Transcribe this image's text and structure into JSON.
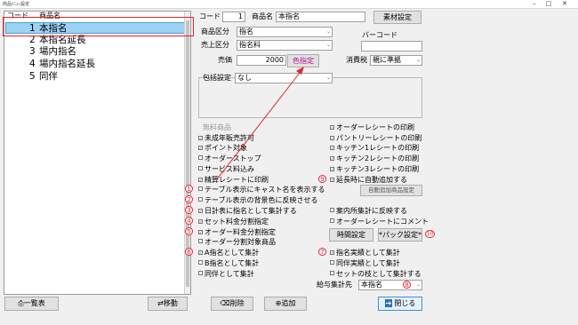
{
  "window": {
    "title": "商品ﾒﾆｭｰ設定"
  },
  "list": {
    "header_code": "コード",
    "header_name": "商品名",
    "items": [
      {
        "code": "1",
        "name": "本指名"
      },
      {
        "code": "2",
        "name": "本指名延長"
      },
      {
        "code": "3",
        "name": "場内指名"
      },
      {
        "code": "4",
        "name": "場内指名延長"
      },
      {
        "code": "5",
        "name": "同伴"
      }
    ]
  },
  "form": {
    "code_label": "コード",
    "code_value": "1",
    "name_label": "商品名",
    "name_value": "本指名",
    "material_button": "素材設定",
    "category_label": "商品区分",
    "category_value": "指名",
    "sales_category_label": "売上区分",
    "sales_category_value": "指名料",
    "barcode_label": "バーコード",
    "barcode_value": "",
    "price_label": "売価",
    "price_value": "2000",
    "color_button": "色指定",
    "tax_label": "消費税",
    "tax_value": "親に準拠",
    "package_label": "包括設定",
    "package_value": "なし"
  },
  "left_checks": [
    {
      "label": "無料商品",
      "checked": false,
      "disabled": true
    },
    {
      "label": "未成年販売許可",
      "checked": true
    },
    {
      "label": "ポイント対象",
      "checked": true
    },
    {
      "label": "オーダーストップ",
      "checked": false
    },
    {
      "label": "サービス料込み",
      "checked": false
    },
    {
      "label": "精算レシートに印刷",
      "checked": true
    },
    {
      "label": "テーブル表示にキャスト名を表示する",
      "checked": false,
      "num": "1"
    },
    {
      "label": "テーブル表示の背景色に反映させる",
      "checked": false,
      "num": "2"
    },
    {
      "label": "日計表に指名として集計する",
      "checked": true,
      "num": "3"
    },
    {
      "label": "セット料金分割指定",
      "checked": true,
      "num": "4"
    },
    {
      "label": "オーダー料金分割指定",
      "checked": true,
      "num": "5"
    },
    {
      "label": "オーダー分割対象商品",
      "checked": false
    },
    {
      "label": "A指名として集計",
      "checked": true,
      "num": "6"
    },
    {
      "label": "B指名として集計",
      "checked": false
    },
    {
      "label": "同伴として集計",
      "checked": false
    }
  ],
  "right_checks": [
    {
      "label": "オーダーレシートの印刷",
      "checked": true
    },
    {
      "label": "パントリーレシートの印刷",
      "checked": true
    },
    {
      "label": "キッチン1レシートの印刷",
      "checked": true
    },
    {
      "label": "キッチン2レシートの印刷",
      "checked": true
    },
    {
      "label": "キッチン3レシートの印刷",
      "checked": true
    },
    {
      "label": "延長時に自動追加する",
      "checked": true,
      "num": "9"
    }
  ],
  "right_checks2": [
    {
      "label": "案内所集計に反映する",
      "checked": false
    },
    {
      "label": "オーダーレシートにコメント",
      "checked": false
    }
  ],
  "right_checks3": [
    {
      "label": "指名実績として集計",
      "checked": true,
      "num": "7"
    },
    {
      "label": "同伴実績として集計",
      "checked": false
    },
    {
      "label": "セットの枝として集計する",
      "checked": false
    }
  ],
  "buttons": {
    "auto_add": "自動追加商品設定",
    "time_setting": "時間設定",
    "pack_setting": "*パック設定*",
    "pack_num": "10",
    "list": "一覧表",
    "move": "移動",
    "delete": "削除",
    "add": "追加",
    "close": "閉じる"
  },
  "salary": {
    "label": "給与集計先",
    "value": "本指名",
    "num": "8"
  },
  "colors": {
    "annotation": "#e2232b",
    "selection": "#9cd2f3",
    "color_button_text": "#b01090"
  }
}
